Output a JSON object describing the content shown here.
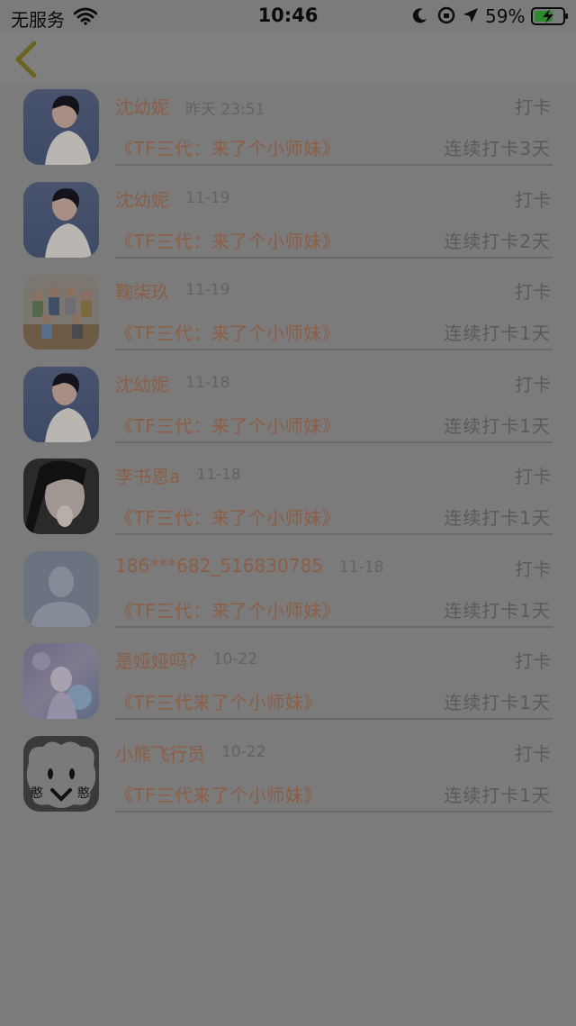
{
  "status_bar": {
    "carrier": "无服务",
    "time": "10:46",
    "battery": "59%"
  },
  "nav": {
    "back_icon": "chevron-left-icon"
  },
  "records": [
    {
      "name": "沈幼妮",
      "time": "昨天 23:51",
      "action": "打卡",
      "title": "《TF三代：来了个小师妹》",
      "streak": "连续打卡3天",
      "avatar": "avatar-girl-white-top"
    },
    {
      "name": "沈幼妮",
      "time": "11-19",
      "action": "打卡",
      "title": "《TF三代：来了个小师妹》",
      "streak": "连续打卡2天",
      "avatar": "avatar-girl-white-top"
    },
    {
      "name": "鞠柒玖",
      "time": "11-19",
      "action": "打卡",
      "title": "《TF三代：来了个小师妹》",
      "streak": "连续打卡1天",
      "avatar": "avatar-group-photo"
    },
    {
      "name": "沈幼妮",
      "time": "11-18",
      "action": "打卡",
      "title": "《TF三代：来了个小师妹》",
      "streak": "连续打卡1天",
      "avatar": "avatar-girl-white-top"
    },
    {
      "name": "李书恩a",
      "time": "11-18",
      "action": "打卡",
      "title": "《TF三代：来了个小师妹》",
      "streak": "连续打卡1天",
      "avatar": "avatar-girl-selfie"
    },
    {
      "name": "186***682_516830785",
      "time": "11-18",
      "action": "打卡",
      "title": "《TF三代：来了个小师妹》",
      "streak": "连续打卡1天",
      "avatar": "avatar-default-person"
    },
    {
      "name": "是娅娅吗?",
      "time": "10-22",
      "action": "打卡",
      "title": "《TF三代来了个小师妹》",
      "streak": "连续打卡1天",
      "avatar": "avatar-anime-art"
    },
    {
      "name": "小熊飞行员",
      "time": "10-22",
      "action": "打卡",
      "title": "《TF三代来了个小师妹》",
      "streak": "连续打卡1天",
      "avatar": "avatar-cartoon-face"
    }
  ],
  "colors": {
    "name": "#8c5e46",
    "meta": "#5a5a5a",
    "background": "#7b7b7b"
  }
}
